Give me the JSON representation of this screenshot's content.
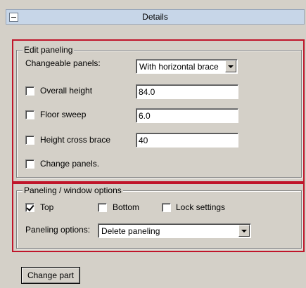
{
  "header": {
    "title": "Details"
  },
  "edit_paneling": {
    "legend": "Edit paneling",
    "changeable_panels_label": "Changeable panels:",
    "changeable_panels_value": "With horizontal brace",
    "overall_height": {
      "label": "Overall height",
      "checked": false,
      "value": "84.0"
    },
    "floor_sweep": {
      "label": "Floor sweep",
      "checked": false,
      "value": "6.0"
    },
    "height_cross_brace": {
      "label": "Height cross brace",
      "checked": false,
      "value": "40"
    },
    "change_panels": {
      "label": "Change panels.",
      "checked": false
    }
  },
  "window_options": {
    "legend": "Paneling / window options",
    "top": {
      "label": "Top",
      "checked": true
    },
    "bottom": {
      "label": "Bottom",
      "checked": false
    },
    "lock_settings": {
      "label": "Lock settings",
      "checked": false
    },
    "paneling_options_label": "Paneling options:",
    "paneling_options_value": "Delete paneling"
  },
  "change_part_button": "Change part",
  "colors": {
    "highlight": "#c0152a",
    "header_bg": "#c7d6e8",
    "window_bg": "#d4d0c8"
  }
}
